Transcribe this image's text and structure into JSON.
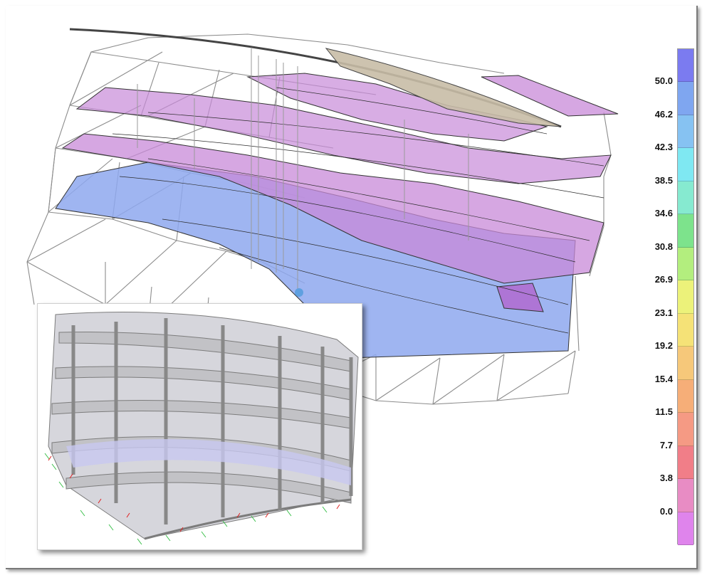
{
  "legend": {
    "values": [
      "50.0",
      "46.2",
      "42.3",
      "38.5",
      "34.6",
      "30.8",
      "26.9",
      "23.1",
      "19.2",
      "15.4",
      "11.5",
      "7.7",
      "3.8",
      "0.0"
    ],
    "colors": [
      "#7b7bf0",
      "#7fa6f0",
      "#86c2f2",
      "#7fe8f2",
      "#86ead0",
      "#7de38c",
      "#b3ee7e",
      "#ecf27a",
      "#f5e277",
      "#f6c87a",
      "#f6ae78",
      "#f59a84",
      "#f17e88",
      "#e88cc4",
      "#df84ec"
    ]
  },
  "colors": {
    "slab_blue": "#8ea8ee",
    "slab_purple": "#c88ad8",
    "slab_tan": "#c8bca6",
    "wire": "#8a8a8a",
    "member": "#b4b4b4"
  },
  "views": {
    "main": "analysis-contour-view",
    "inset": "extruded-member-view"
  }
}
